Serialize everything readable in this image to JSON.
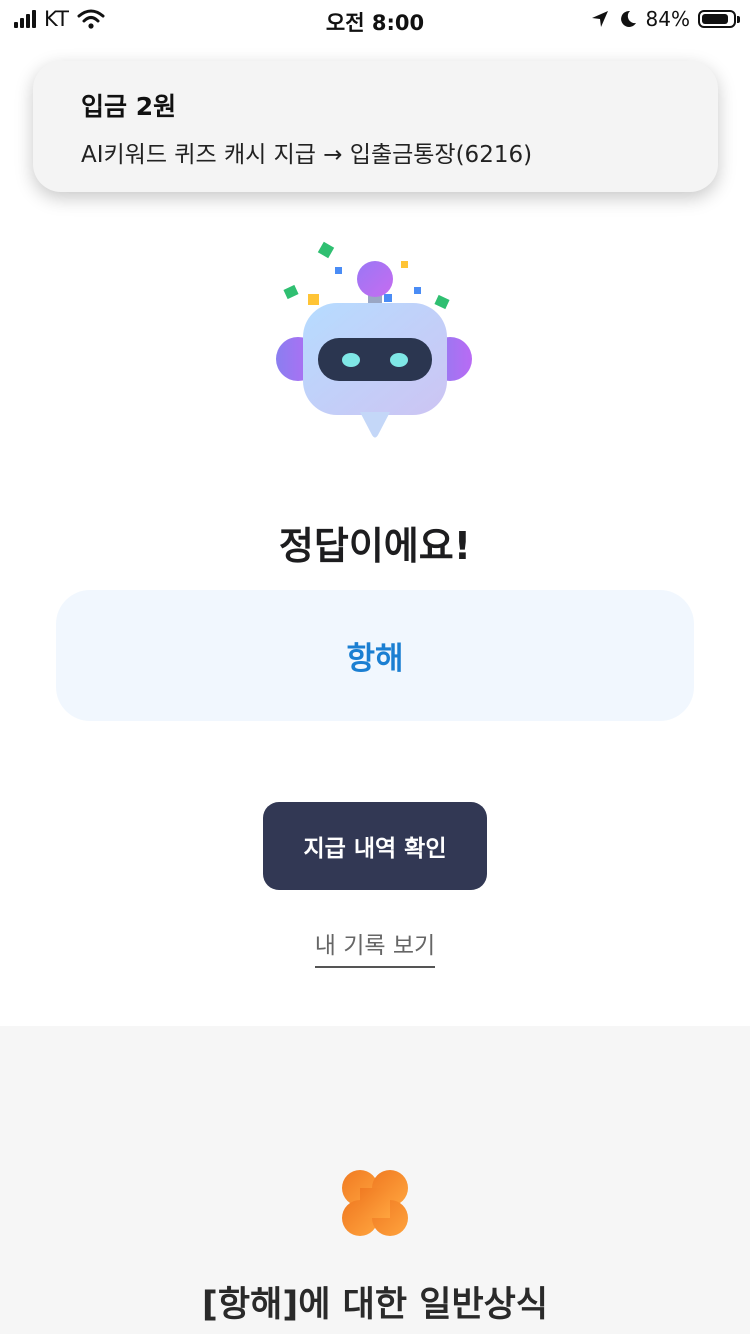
{
  "status_bar": {
    "carrier": "KT",
    "time": "오전 8:00",
    "battery_percent": "84%",
    "icons": [
      "signal-icon",
      "wifi-icon",
      "location-arrow-icon",
      "moon-icon",
      "battery-icon"
    ]
  },
  "notification": {
    "title": "입금 2원",
    "body": "AI키워드 퀴즈 캐시 지급 → 입출금통장(6216)"
  },
  "result": {
    "headline": "정답이에요!",
    "answer": "항해"
  },
  "actions": {
    "pay_history_button": "지급 내역 확인",
    "my_record_link": "내 기록 보기"
  },
  "info": {
    "title": "[항해]에 대한 일반상식",
    "icon": "clover-icon"
  },
  "colors": {
    "answer_text": "#1b7fd2",
    "answer_bg": "#f1f7fe",
    "button_bg": "#323854",
    "clover": "#f08a24"
  }
}
